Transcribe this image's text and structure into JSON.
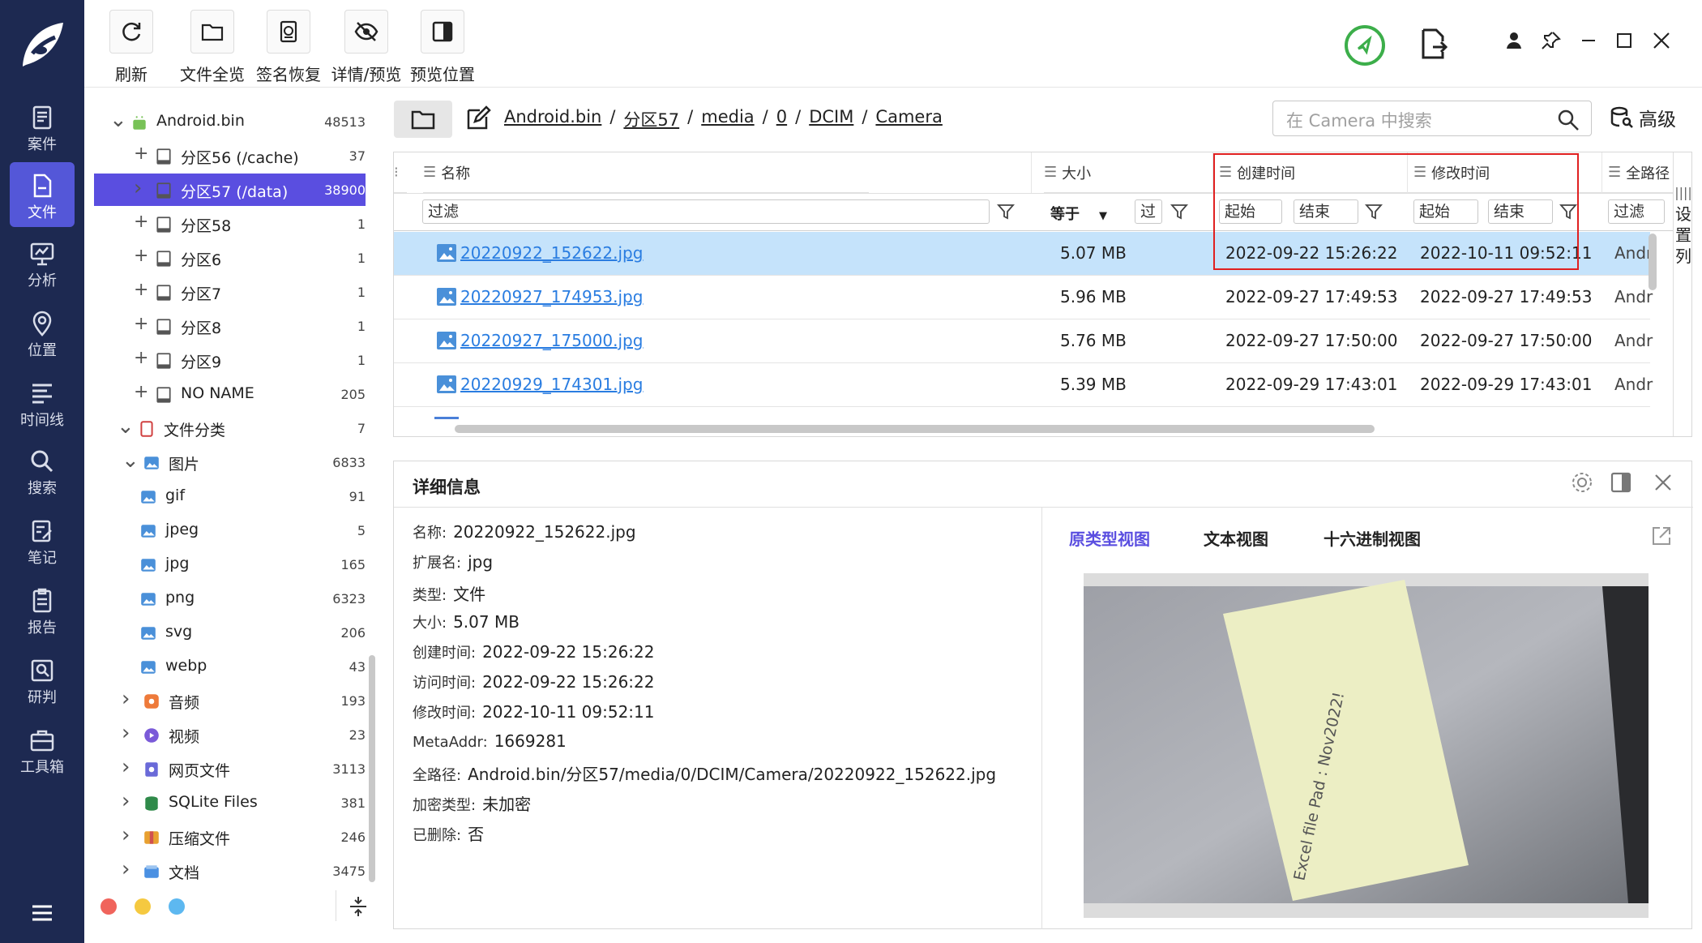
{
  "nav": {
    "items": [
      {
        "label": "案件",
        "icon": "case-icon"
      },
      {
        "label": "文件",
        "icon": "file-icon"
      },
      {
        "label": "分析",
        "icon": "analysis-icon"
      },
      {
        "label": "位置",
        "icon": "location-icon"
      },
      {
        "label": "时间线",
        "icon": "timeline-icon"
      },
      {
        "label": "搜索",
        "icon": "search-icon"
      },
      {
        "label": "笔记",
        "icon": "note-icon"
      },
      {
        "label": "报告",
        "icon": "report-icon"
      },
      {
        "label": "研判",
        "icon": "judge-icon"
      },
      {
        "label": "工具箱",
        "icon": "toolbox-icon"
      }
    ],
    "active": "文件"
  },
  "toolbar": {
    "refresh": "刷新",
    "all_files": "文件全览",
    "sig_recover": "签名恢复",
    "detail_preview": "详情/预览",
    "preview_pos": "预览位置"
  },
  "tree": {
    "rows": [
      {
        "label": "Android.bin",
        "count": "48513"
      },
      {
        "label": "分区56  (/cache)",
        "count": "37"
      },
      {
        "label": "分区57  (/data)",
        "count": "38900"
      },
      {
        "label": "分区58",
        "count": "1"
      },
      {
        "label": "分区6",
        "count": "1"
      },
      {
        "label": "分区7",
        "count": "1"
      },
      {
        "label": "分区8",
        "count": "1"
      },
      {
        "label": "分区9",
        "count": "1"
      },
      {
        "label": "NO NAME",
        "count": "205"
      },
      {
        "label": "文件分类",
        "count": "7"
      },
      {
        "label": "图片",
        "count": "6833"
      },
      {
        "label": "gif",
        "count": "91"
      },
      {
        "label": "jpeg",
        "count": "5"
      },
      {
        "label": "jpg",
        "count": "165"
      },
      {
        "label": "png",
        "count": "6323"
      },
      {
        "label": "svg",
        "count": "206"
      },
      {
        "label": "webp",
        "count": "43"
      },
      {
        "label": "音频",
        "count": "193"
      },
      {
        "label": "视频",
        "count": "23"
      },
      {
        "label": "网页文件",
        "count": "3113"
      },
      {
        "label": "SQLite Files",
        "count": "381"
      },
      {
        "label": "压缩文件",
        "count": "246"
      },
      {
        "label": "文档",
        "count": "3475"
      }
    ]
  },
  "path": {
    "crumbs": [
      "Android.bin",
      "分区57",
      "media",
      "0",
      "DCIM",
      "Camera"
    ],
    "sep": "/",
    "search_placeholder": "在 Camera 中搜索",
    "advanced": "高级"
  },
  "grid": {
    "headers": {
      "name": "名称",
      "size": "大小",
      "created": "创建时间",
      "modified": "修改时间",
      "fullpath": "全路径"
    },
    "filters": {
      "name": "过滤",
      "size_op": "等于",
      "size_val": "过",
      "start": "起始",
      "end": "结束",
      "path": "过滤"
    },
    "side_label": "设置列",
    "rows": [
      {
        "name": "20220922_152622.jpg",
        "size": "5.07 MB",
        "created": "2022-09-22 15:26:22",
        "modified": "2022-10-11 09:52:11",
        "path": "Andr"
      },
      {
        "name": "20220927_174953.jpg",
        "size": "5.96 MB",
        "created": "2022-09-27 17:49:53",
        "modified": "2022-09-27 17:49:53",
        "path": "Andr"
      },
      {
        "name": "20220927_175000.jpg",
        "size": "5.76 MB",
        "created": "2022-09-27 17:50:00",
        "modified": "2022-09-27 17:50:00",
        "path": "Andr"
      },
      {
        "name": "20220929_174301.jpg",
        "size": "5.39 MB",
        "created": "2022-09-29 17:43:01",
        "modified": "2022-09-29 17:43:01",
        "path": "Andr"
      }
    ]
  },
  "detail": {
    "title": "详细信息",
    "fields": [
      {
        "k": "名称:",
        "v": "20220922_152622.jpg"
      },
      {
        "k": "扩展名:",
        "v": "jpg"
      },
      {
        "k": "类型:",
        "v": "文件"
      },
      {
        "k": "大小:",
        "v": "5.07 MB"
      },
      {
        "k": "创建时间:",
        "v": "2022-09-22 15:26:22"
      },
      {
        "k": "访问时间:",
        "v": "2022-09-22 15:26:22"
      },
      {
        "k": "修改时间:",
        "v": "2022-10-11 09:52:11"
      },
      {
        "k": "MetaAddr:",
        "v": "1669281"
      },
      {
        "k": "全路径:",
        "v": "Android.bin/分区57/media/0/DCIM/Camera/20220922_152622.jpg"
      },
      {
        "k": "加密类型:",
        "v": "未加密"
      },
      {
        "k": "已删除:",
        "v": "否"
      }
    ],
    "tabs": [
      "原类型视图",
      "文本视图",
      "十六进制视图"
    ],
    "active_tab": "原类型视图",
    "photo_text": "Excel file Pad : Nov2022!"
  },
  "colors": {
    "nav_bg": "#1d2951",
    "accent": "#5a4ee0",
    "link": "#2a7de1",
    "row_sel": "#c5e3fb",
    "highlight": "#e02020"
  }
}
